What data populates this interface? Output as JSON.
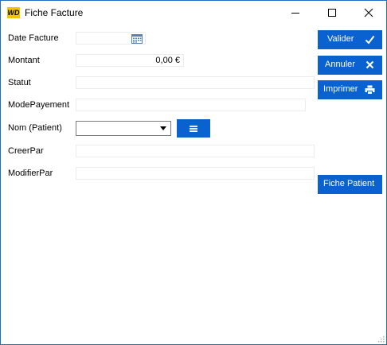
{
  "window": {
    "title": "Fiche Facture",
    "app_icon_text": "WD",
    "accent_color": "#0a62d0",
    "border_color": "#1f6fc5"
  },
  "form": {
    "date_facture": {
      "label": "Date Facture",
      "value": ""
    },
    "montant": {
      "label": "Montant",
      "value": "0,00 €"
    },
    "statut": {
      "label": "Statut",
      "value": ""
    },
    "mode_payement": {
      "label": "ModePayement",
      "value": ""
    },
    "nom_patient": {
      "label": "Nom (Patient)",
      "selected": ""
    },
    "creer_par": {
      "label": "CreerPar",
      "value": ""
    },
    "modifier_par": {
      "label": "ModifierPar",
      "value": ""
    }
  },
  "buttons": {
    "valider": "Valider",
    "annuler": "Annuler",
    "imprimer": "Imprimer",
    "fiche_patient": "Fiche Patient"
  },
  "icons": {
    "calendar": "calendar-icon",
    "check": "check-icon",
    "close": "close-x-icon",
    "print": "printer-icon",
    "list": "list-icon",
    "minimize": "minimize-icon",
    "maximize": "maximize-icon",
    "window_close": "close-icon"
  }
}
